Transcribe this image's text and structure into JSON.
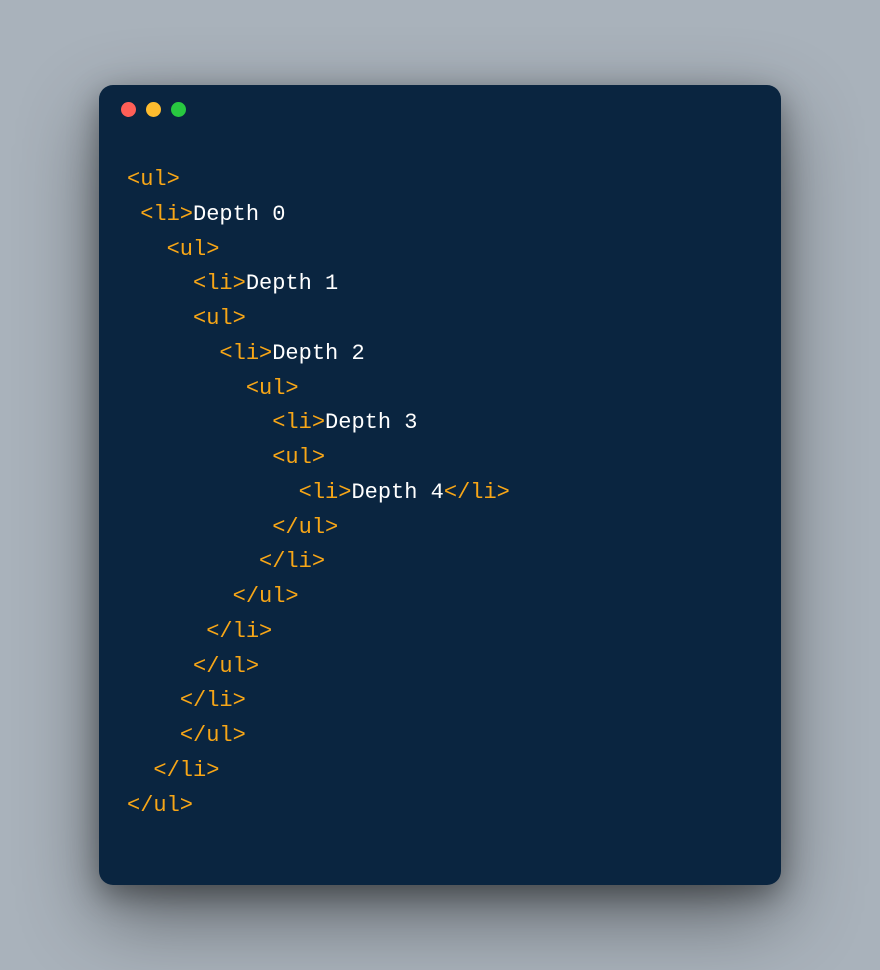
{
  "colors": {
    "background_page": "#a9b2bb",
    "window": "#0a2540",
    "tag": "#f7a617",
    "text": "#ffffff",
    "traffic_close": "#ff5f57",
    "traffic_min": "#febc2e",
    "traffic_max": "#28c840"
  },
  "code": {
    "lines": [
      [
        {
          "type": "tag",
          "text": "<ul>"
        }
      ],
      [
        {
          "type": "plain",
          "text": " "
        },
        {
          "type": "tag",
          "text": "<li>"
        },
        {
          "type": "txt",
          "text": "Depth 0"
        }
      ],
      [
        {
          "type": "plain",
          "text": "   "
        },
        {
          "type": "tag",
          "text": "<ul>"
        }
      ],
      [
        {
          "type": "plain",
          "text": "     "
        },
        {
          "type": "tag",
          "text": "<li>"
        },
        {
          "type": "txt",
          "text": "Depth 1"
        }
      ],
      [
        {
          "type": "plain",
          "text": "     "
        },
        {
          "type": "tag",
          "text": "<ul>"
        }
      ],
      [
        {
          "type": "plain",
          "text": "       "
        },
        {
          "type": "tag",
          "text": "<li>"
        },
        {
          "type": "txt",
          "text": "Depth 2"
        }
      ],
      [
        {
          "type": "plain",
          "text": "         "
        },
        {
          "type": "tag",
          "text": "<ul>"
        }
      ],
      [
        {
          "type": "plain",
          "text": "           "
        },
        {
          "type": "tag",
          "text": "<li>"
        },
        {
          "type": "txt",
          "text": "Depth 3"
        }
      ],
      [
        {
          "type": "plain",
          "text": "           "
        },
        {
          "type": "tag",
          "text": "<ul>"
        }
      ],
      [
        {
          "type": "plain",
          "text": "             "
        },
        {
          "type": "tag",
          "text": "<li>"
        },
        {
          "type": "txt",
          "text": "Depth 4"
        },
        {
          "type": "tag",
          "text": "</li>"
        }
      ],
      [
        {
          "type": "plain",
          "text": "           "
        },
        {
          "type": "tag",
          "text": "</ul>"
        }
      ],
      [
        {
          "type": "plain",
          "text": "          "
        },
        {
          "type": "tag",
          "text": "</li>"
        }
      ],
      [
        {
          "type": "plain",
          "text": "        "
        },
        {
          "type": "tag",
          "text": "</ul>"
        }
      ],
      [
        {
          "type": "plain",
          "text": "      "
        },
        {
          "type": "tag",
          "text": "</li>"
        }
      ],
      [
        {
          "type": "plain",
          "text": "     "
        },
        {
          "type": "tag",
          "text": "</ul>"
        }
      ],
      [
        {
          "type": "plain",
          "text": "    "
        },
        {
          "type": "tag",
          "text": "</li>"
        }
      ],
      [
        {
          "type": "plain",
          "text": "    "
        },
        {
          "type": "tag",
          "text": "</ul>"
        }
      ],
      [
        {
          "type": "plain",
          "text": "  "
        },
        {
          "type": "tag",
          "text": "</li>"
        }
      ],
      [
        {
          "type": "tag",
          "text": "</ul>"
        }
      ]
    ]
  }
}
